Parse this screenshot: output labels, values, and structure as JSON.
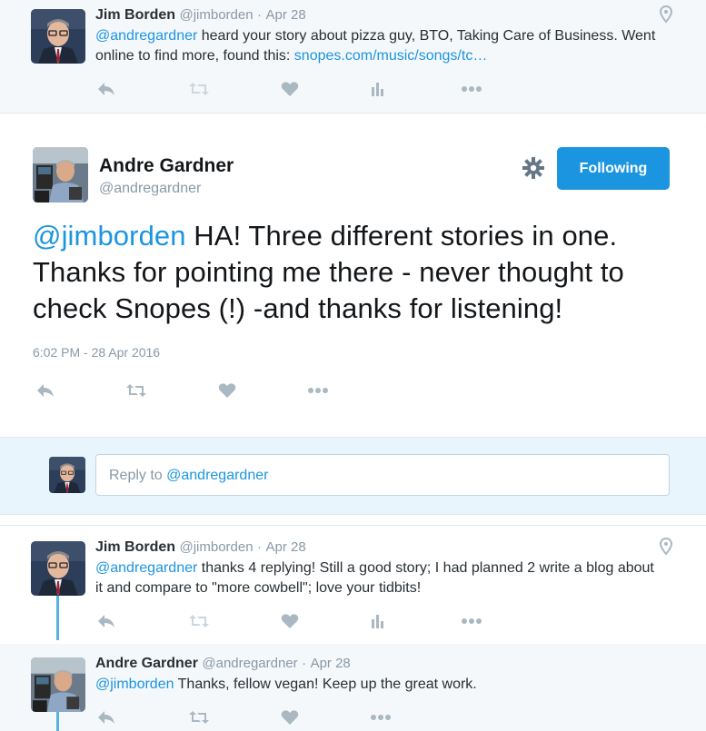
{
  "tweets": {
    "top": {
      "name": "Jim Borden",
      "handle": "@jimborden",
      "dot": "·",
      "date": "Apr 28",
      "mention": "@andregardner",
      "text_part1": " heard your story about pizza guy, BTO, Taking Care of Business. Went online to find more, found this: ",
      "link": "snopes.com/music/songs/tc…"
    },
    "main": {
      "name": "Andre Gardner",
      "handle": "@andregardner",
      "follow_label": "Following",
      "mention": "@jimborden",
      "text": " HA!  Three different stories in one. Thanks for pointing me there - never thought to check Snopes (!) -and thanks for listening!",
      "timestamp": "6:02 PM - 28 Apr 2016"
    },
    "reply_box": {
      "prefix": "Reply to ",
      "mention": "@andregardner"
    },
    "reply1": {
      "name": "Jim Borden",
      "handle": "@jimborden",
      "dot": "·",
      "date": "Apr 28",
      "mention": "@andregardner",
      "text": " thanks 4 replying! Still a good story; I had planned 2 write a blog about it and compare to \"more cowbell\"; love your tidbits!"
    },
    "reply2": {
      "name": "Andre Gardner",
      "handle": "@andregardner",
      "dot": "·",
      "date": "Apr 28",
      "mention": "@jimborden",
      "text": " Thanks, fellow vegan!  Keep up the great work."
    }
  },
  "icons": [
    "reply-icon",
    "retweet-icon",
    "like-icon",
    "analytics-icon",
    "more-icon",
    "location-icon",
    "gear-icon"
  ],
  "colors": {
    "accent": "#1b95e0",
    "icon": "#aab8c2",
    "thread_line": "#55b4e2",
    "text": "#292f33",
    "muted": "#8899a6"
  }
}
